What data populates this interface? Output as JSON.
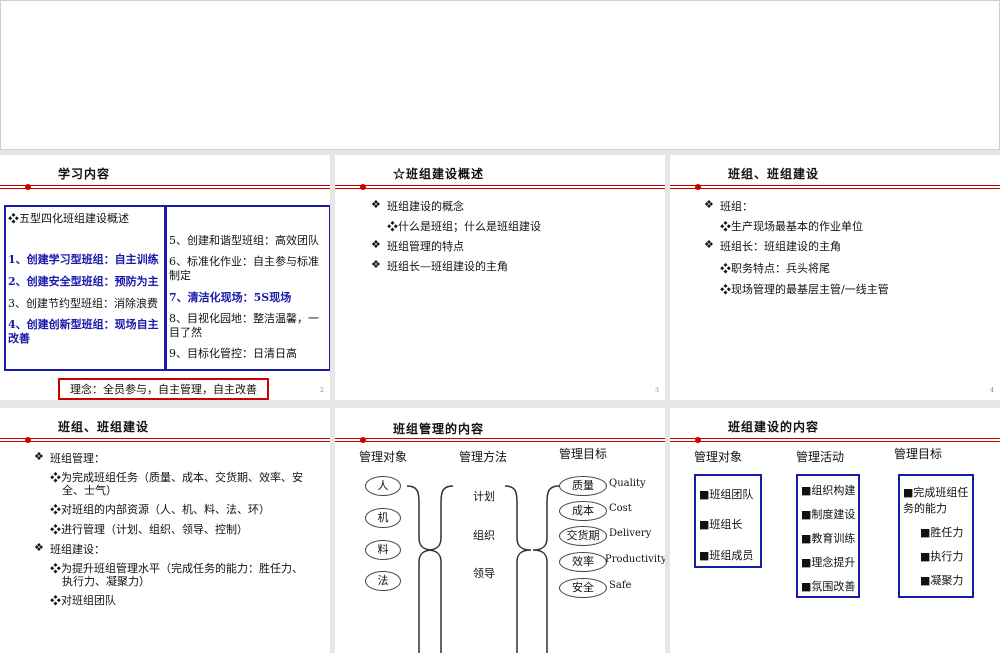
{
  "slides": {
    "s2": {
      "title": "学习内容",
      "left_header": "❖五型四化班组建设概述",
      "left_items": [
        "1、创建学习型班组：自主训练",
        "2、创建安全型班组：预防为主",
        "3、创建节约型班组：消除浪费",
        "4、创建创新型班组：现场自主",
        "改善"
      ],
      "right_items": [
        "5、创建和谐型班组：高效团队",
        "6、标准化作业：自主参与标准",
        "制定",
        "7、清洁化现场：5S现场",
        "8、目视化园地：整洁温馨，一",
        "目了然",
        "9、目标化管控：日清日高"
      ],
      "concept": "理念：全员参与，自主管理，自主改善",
      "page": "2"
    },
    "s3": {
      "title": "☆班组建设概述",
      "items": [
        "班组建设的概念",
        "❖什么是班组；什么是班组建设",
        "班组管理的特点",
        "班组长—班组建设的主角"
      ],
      "page": "3"
    },
    "s4": {
      "title": "班组、班组建设",
      "items": [
        "班组：",
        "❖生产现场最基本的作业单位",
        "班组长：班组建设的主角",
        "❖职务特点：兵头将尾",
        "❖现场管理的最基层主管/一线主管"
      ],
      "page": "4"
    },
    "s5": {
      "title": "班组、班组建设",
      "items": [
        "班组管理：",
        "❖为完成班组任务（质量、成本、交货期、效率、安",
        "全、士气）",
        "❖对班组的内部资源（人、机、料、法、环）",
        "❖进行管理（计划、组织、领导、控制）",
        "班组建设：",
        "❖为提升班组管理水平（完成任务的能力：胜任力、",
        "执行力、凝聚力）",
        "❖对班组团队"
      ]
    },
    "s6": {
      "title": "班组管理的内容",
      "h1": "管理对象",
      "h2": "管理方法",
      "h3": "管理目标",
      "objects": [
        "人",
        "机",
        "料",
        "法"
      ],
      "methods": [
        "计划",
        "组织",
        "领导"
      ],
      "goals": [
        {
          "cn": "质量",
          "en": "Quality"
        },
        {
          "cn": "成本",
          "en": "Cost"
        },
        {
          "cn": "交货期",
          "en": "Delivery"
        },
        {
          "cn": "效率",
          "en": "Productivity"
        },
        {
          "cn": "安全",
          "en": "Safe"
        }
      ]
    },
    "s7": {
      "title": "班组建设的内容",
      "h1": "管理对象",
      "h2": "管理活动",
      "h3": "管理目标",
      "objects": [
        "■班组团队",
        "■班组长",
        "■班组成员"
      ],
      "activities": [
        "■组织构建",
        "■制度建设",
        "■教育训练",
        "■理念提升",
        "■氛围改善"
      ],
      "goal_head": [
        "■完成班组任",
        "务的能力"
      ],
      "goals": [
        "■胜任力",
        "■执行力",
        "■凝聚力"
      ]
    }
  },
  "colors": {
    "accent_red": "#cc0000",
    "box_blue": "#1a1aa8"
  }
}
